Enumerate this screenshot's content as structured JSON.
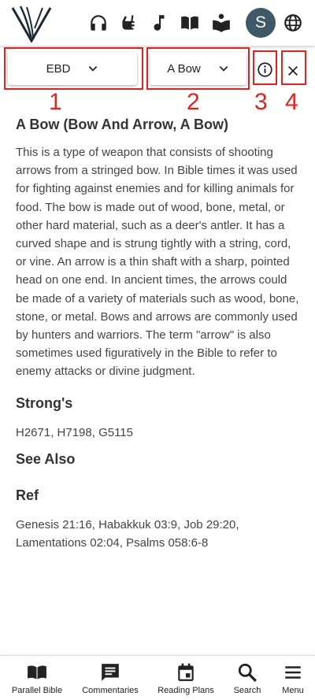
{
  "header": {
    "icons": [
      "logo-icon",
      "headphones-icon",
      "sign-language-icon",
      "music-note-icon",
      "book-open-icon",
      "reading-icon",
      "globe-icon"
    ],
    "avatar_initial": "S"
  },
  "selectors": {
    "source": "EBD",
    "entry": "A Bow"
  },
  "annotations": [
    "1",
    "2",
    "3",
    "4"
  ],
  "entry": {
    "title": "A Bow (Bow And Arrow, A Bow)",
    "definition": "This is a type of weapon that consists of shooting arrows from a stringed bow. In Bible times it was used for fighting against enemies and for killing animals for food. The bow is made out of wood, bone, metal, or other hard material, such as a deer's antler. It has a curved shape and is strung tightly with a string, cord, or vine. An arrow is a thin shaft with a sharp, pointed head on one end. In ancient times, the arrows could be made of a variety of materials such as wood, bone, stone, or metal. Bows and arrows are commonly used by hunters and warriors. The term \"arrow\" is also sometimes used figuratively in the Bible to refer to enemy attacks or divine judgment.",
    "strongs_heading": "Strong's",
    "strongs": "H2671, H7198, G5115",
    "see_also_heading": "See Also",
    "ref_heading": "Ref",
    "refs": "Genesis 21:16, Habakkuk 03:9, Job 29:20, Lamentations 02:04, Psalms 058:6-8"
  },
  "bottom_nav": [
    {
      "label": "Parallel Bible",
      "icon": "book-icon"
    },
    {
      "label": "Commentaries",
      "icon": "comment-icon"
    },
    {
      "label": "Reading Plans",
      "icon": "calendar-icon"
    },
    {
      "label": "Search",
      "icon": "search-icon"
    },
    {
      "label": "Menu",
      "icon": "menu-icon"
    }
  ]
}
